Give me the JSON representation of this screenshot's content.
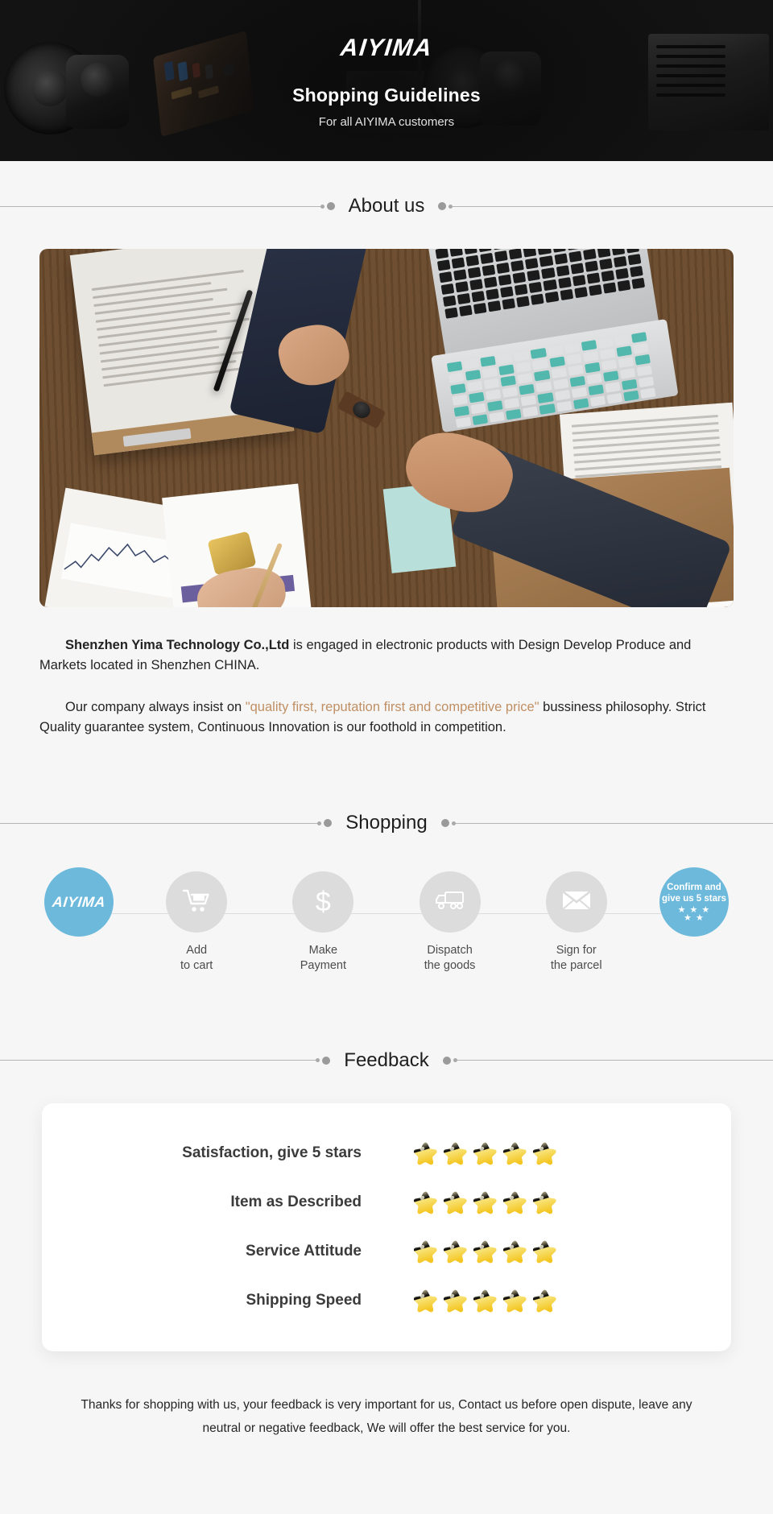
{
  "hero": {
    "logo": "AIYIMA",
    "title": "Shopping Guidelines",
    "subtitle": "For all AIYIMA customers"
  },
  "sections": {
    "about": "About us",
    "shopping": "Shopping",
    "feedback": "Feedback"
  },
  "about": {
    "paragraph1_company": "Shenzhen Yima Technology Co.,Ltd",
    "paragraph1_rest": " is engaged in electronic products with Design Develop Produce and Markets located in Shenzhen CHINA.",
    "paragraph2_start": "Our company always insist on ",
    "paragraph2_quote": "\"quality first, reputation first and competitive price\"",
    "paragraph2_end": " bussiness philosophy. Strict Quality guarantee system, Continuous Innovation is our foothold in competition."
  },
  "shopping": {
    "brand_logo": "AIYIMA",
    "steps": [
      {
        "icon": "cart-icon",
        "label": "Add\nto cart"
      },
      {
        "icon": "dollar-icon",
        "label": "Make\nPayment"
      },
      {
        "icon": "truck-icon",
        "label": "Dispatch\nthe goods"
      },
      {
        "icon": "envelope-icon",
        "label": "Sign for\nthe parcel"
      }
    ],
    "confirm": {
      "text": "Confirm and\ngive us 5 stars",
      "stars_row1": "★ ★ ★",
      "stars_row2": "★ ★"
    }
  },
  "feedback": {
    "rows": [
      {
        "label": "Satisfaction, give 5 stars",
        "stars": 5
      },
      {
        "label": "Item as Described",
        "stars": 5
      },
      {
        "label": "Service Attitude",
        "stars": 5
      },
      {
        "label": "Shipping Speed",
        "stars": 5
      }
    ]
  },
  "footer": {
    "note": "Thanks for shopping with us, your feedback is very important for us, Contact us before open dispute, leave any neutral or negative feedback, We will offer the best service for you."
  },
  "colors": {
    "accent_blue": "#6cb9dc",
    "quote_brown": "#c08f63",
    "star_gold": "#f6d33f",
    "hero_bg": "#131313",
    "page_bg": "#f6f6f6"
  }
}
